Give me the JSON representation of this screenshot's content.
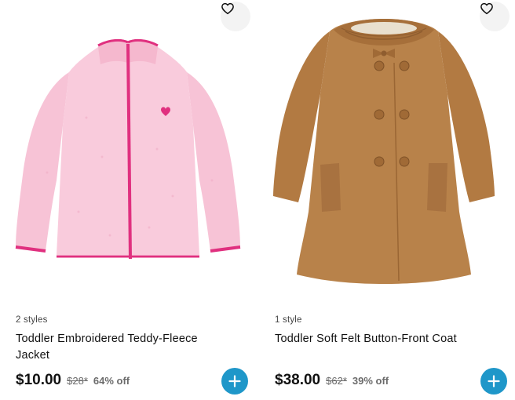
{
  "products": [
    {
      "image_icon": "pink-fleece-jacket-image",
      "styles_count": "2 styles",
      "name": "Toddler Embroidered Teddy-Fleece Jacket",
      "sale_price": "$10.00",
      "original_price": "$28*",
      "discount": "64% off",
      "favorite_icon": "heart-outline-icon",
      "add_icon": "plus-icon"
    },
    {
      "image_icon": "brown-felt-coat-image",
      "styles_count": "1 style",
      "name": "Toddler Soft Felt Button-Front Coat",
      "sale_price": "$38.00",
      "original_price": "$62*",
      "discount": "39% off",
      "favorite_icon": "heart-outline-icon",
      "add_icon": "plus-icon"
    }
  ],
  "colors": {
    "accent": "#1f97c9",
    "favorite_bg": "#f3f3f3",
    "jacket_pink": "#f7c3d6",
    "jacket_trim": "#e0307f",
    "coat_brown": "#b27a42"
  }
}
